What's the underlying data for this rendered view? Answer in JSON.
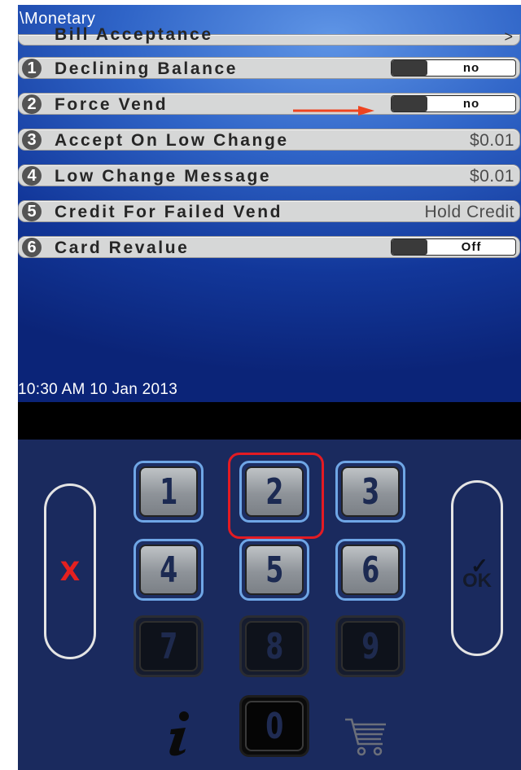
{
  "screen": {
    "breadcrumb": "\\Monetary",
    "partial_row": {
      "label": "Bill Acceptance",
      "chevron": ">"
    },
    "rows": [
      {
        "num": "1",
        "label": "Declining Balance",
        "type": "toggle",
        "value": "no"
      },
      {
        "num": "2",
        "label": "Force Vend",
        "type": "toggle",
        "value": "no"
      },
      {
        "num": "3",
        "label": "Accept On Low Change",
        "type": "text",
        "value": "$0.01"
      },
      {
        "num": "4",
        "label": "Low Change Message",
        "type": "text",
        "value": "$0.01"
      },
      {
        "num": "5",
        "label": "Credit For Failed Vend",
        "type": "text",
        "value": "Hold Credit"
      },
      {
        "num": "6",
        "label": "Card Revalue",
        "type": "toggle",
        "value": "Off"
      }
    ],
    "timestamp": "10:30 AM 10 Jan 2013"
  },
  "keypad": {
    "keys": [
      "1",
      "2",
      "3",
      "4",
      "5",
      "6",
      "7",
      "8",
      "9",
      "0"
    ],
    "cancel_label": "X",
    "ok_label": "OK",
    "ok_check": "✓",
    "highlighted_key": "2"
  },
  "colors": {
    "accent_arrow": "#ee4420",
    "highlight": "#e31b23",
    "screen_blue": "#2f64c7",
    "keypad_bg": "#1a2a5e"
  },
  "icons": {
    "annotation": "arrow-right-icon",
    "info": "info-icon",
    "cart": "shopping-cart-icon"
  }
}
